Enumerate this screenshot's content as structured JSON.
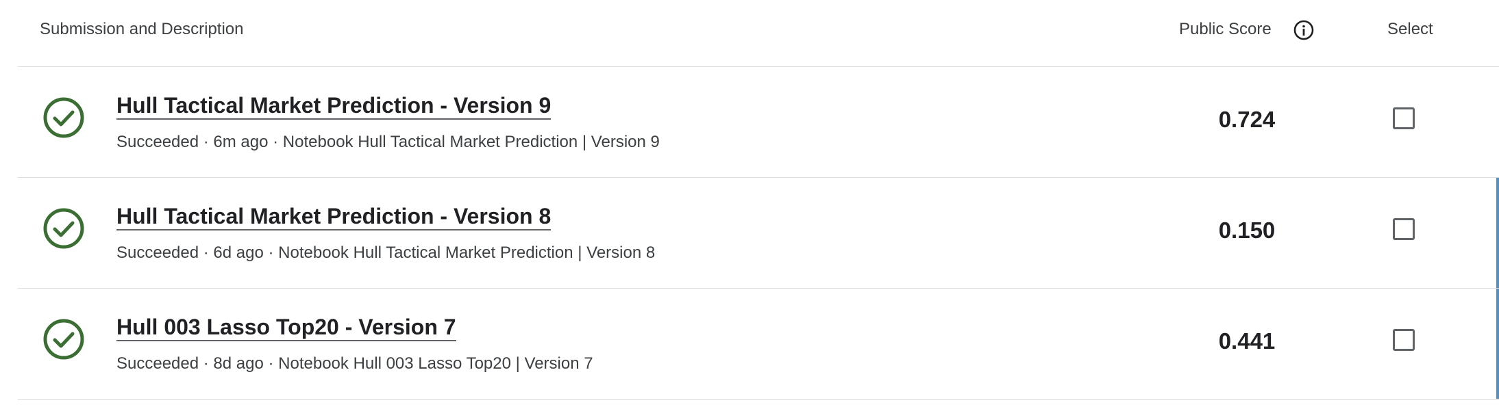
{
  "header": {
    "submission_label": "Submission and Description",
    "score_label": "Public Score",
    "select_label": "Select"
  },
  "rows": [
    {
      "title": "Hull Tactical Market Prediction - Version 9",
      "meta": "Succeeded · 6m ago · Notebook Hull Tactical Market Prediction | Version 9",
      "score": "0.724",
      "status_icon": "check-circle-icon",
      "selected": false
    },
    {
      "title": "Hull Tactical Market Prediction - Version 8",
      "meta": "Succeeded · 6d ago · Notebook Hull Tactical Market Prediction | Version 8",
      "score": "0.150",
      "status_icon": "check-circle-icon",
      "selected": false
    },
    {
      "title": "Hull 003 Lasso Top20 - Version 7",
      "meta": "Succeeded · 8d ago · Notebook Hull 003 Lasso Top20 | Version 7",
      "score": "0.441",
      "status_icon": "check-circle-icon",
      "selected": false
    }
  ],
  "colors": {
    "success": "#3b6e33",
    "accent_bar": "#5c8fb8",
    "divider": "#dadce0"
  }
}
